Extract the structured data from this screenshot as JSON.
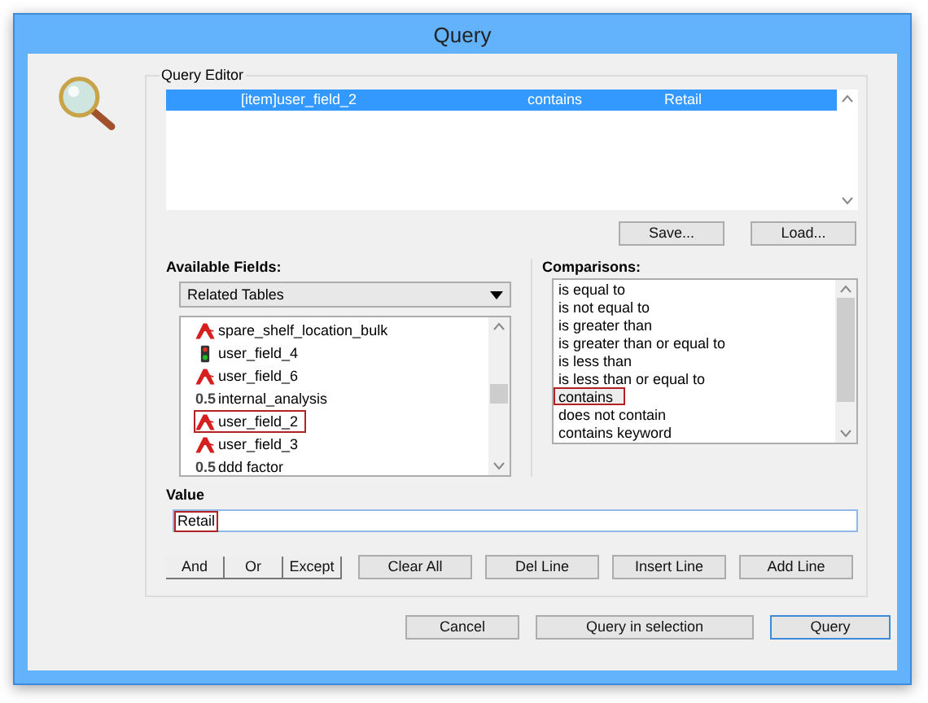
{
  "window": {
    "title": "Query"
  },
  "query_editor": {
    "title": "Query Editor",
    "rows": [
      {
        "field": "[item]user_field_2",
        "comparison": "contains",
        "value": "Retail",
        "selected": true
      }
    ],
    "buttons": [
      "Save...",
      "Load..."
    ]
  },
  "available_fields": {
    "label": "Available Fields:",
    "dropdown": "Related Tables",
    "items": [
      {
        "kind": "text",
        "name": "spare_shelf_location_bulk",
        "highlighted": false
      },
      {
        "kind": "flag",
        "name": "user_field_4",
        "highlighted": false
      },
      {
        "kind": "text",
        "name": "user_field_6",
        "highlighted": false
      },
      {
        "kind": "number",
        "icon_text": "0.5",
        "name": "internal_analysis",
        "highlighted": false
      },
      {
        "kind": "text",
        "name": "user_field_2",
        "highlighted": true
      },
      {
        "kind": "text",
        "name": "user_field_3",
        "highlighted": false
      },
      {
        "kind": "number",
        "icon_text": "0.5",
        "name": "ddd factor",
        "highlighted": false
      }
    ]
  },
  "comparisons": {
    "label": "Comparisons:",
    "items": [
      {
        "label": "is equal to",
        "selected": false,
        "highlighted": false
      },
      {
        "label": "is not equal to",
        "selected": false,
        "highlighted": false
      },
      {
        "label": "is greater than",
        "selected": false,
        "highlighted": false
      },
      {
        "label": "is greater than or equal to",
        "selected": false,
        "highlighted": false
      },
      {
        "label": "is less than",
        "selected": false,
        "highlighted": false
      },
      {
        "label": "is less than or equal to",
        "selected": false,
        "highlighted": false
      },
      {
        "label": "contains",
        "selected": true,
        "highlighted": true
      },
      {
        "label": "does not contain",
        "selected": false,
        "highlighted": false
      },
      {
        "label": "contains keyword",
        "selected": false,
        "highlighted": false
      }
    ]
  },
  "value": {
    "label": "Value",
    "text": "Retail",
    "highlighted": true
  },
  "logic_buttons": [
    "And",
    "Or",
    "Except"
  ],
  "line_buttons": [
    "Clear All",
    "Del Line",
    "Insert Line",
    "Add Line"
  ],
  "dialog_buttons": [
    {
      "label": "Cancel",
      "default": false
    },
    {
      "label": "Query in selection",
      "default": false
    },
    {
      "label": "Query",
      "default": true
    }
  ]
}
